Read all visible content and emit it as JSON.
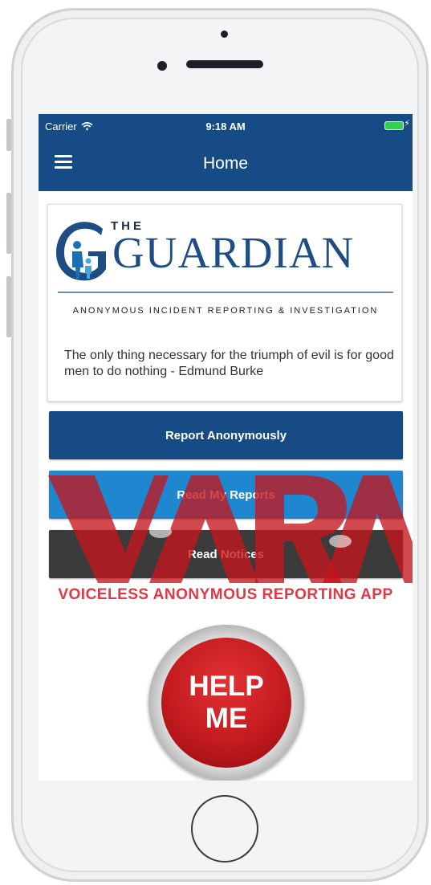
{
  "status_bar": {
    "carrier": "Carrier",
    "time": "9:18 AM"
  },
  "nav": {
    "title": "Home",
    "menu_icon": "hamburger-icon"
  },
  "logo": {
    "the": "THE",
    "word": "GUARDIAN",
    "subtitle": "ANONYMOUS INCIDENT REPORTING & INVESTIGATION"
  },
  "quote": "The only thing necessary for the triumph of evil is for good men to do nothing - Edmund Burke",
  "buttons": {
    "report": "Report Anonymously",
    "read_reports": "Read My Reports",
    "read_notices": "Read Notices"
  },
  "watermark": {
    "mark": "VARA",
    "caption": "VOICELESS ANONYMOUS REPORTING APP"
  },
  "help_button": {
    "line1": "HELP",
    "line2": "ME"
  },
  "colors": {
    "primary": "#174b86",
    "secondary": "#1e87d0",
    "dark": "#3b3b3b",
    "help_red": "#c41b1f",
    "watermark_red": "#de3a45"
  }
}
